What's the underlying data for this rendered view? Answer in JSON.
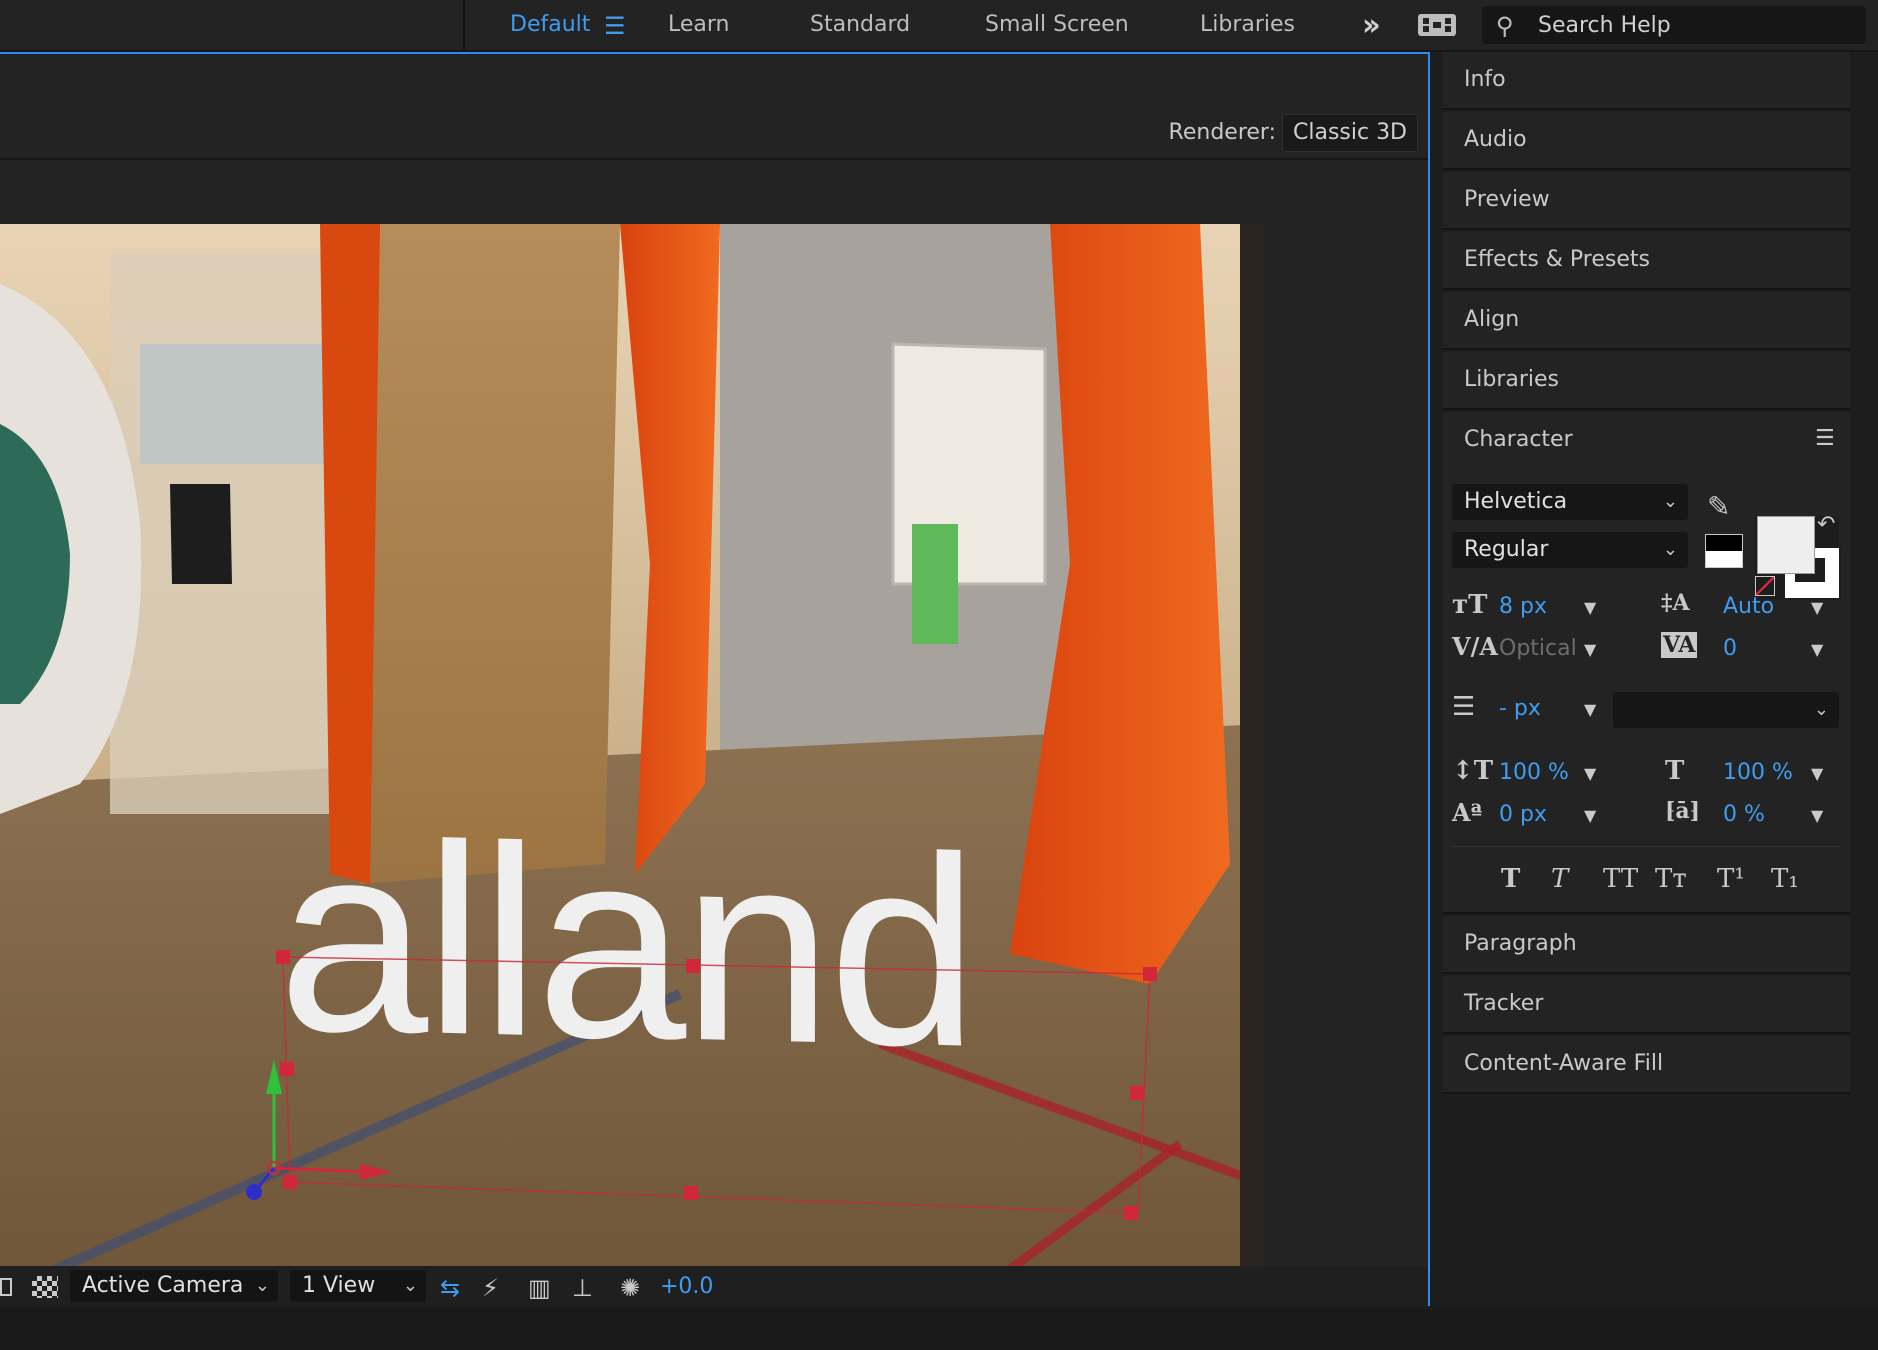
{
  "workspace": {
    "tabs": [
      "Default",
      "Learn",
      "Standard",
      "Small Screen",
      "Libraries"
    ],
    "active_tab": "Default",
    "search_placeholder": "Search Help"
  },
  "composition": {
    "renderer_label": "Renderer:",
    "renderer_value": "Classic 3D",
    "text_layer": "alland",
    "footer": {
      "camera": "Active Camera",
      "views": "1 View",
      "exposure": "+0.0"
    }
  },
  "panels": {
    "collapsed_top": [
      "Info",
      "Audio",
      "Preview",
      "Effects & Presets",
      "Align",
      "Libraries"
    ],
    "character_title": "Character",
    "collapsed_bottom": [
      "Paragraph",
      "Tracker",
      "Content-Aware Fill"
    ]
  },
  "character": {
    "font_family": "Helvetica",
    "font_style": "Regular",
    "font_size": "8 px",
    "leading": "Auto",
    "kerning": "Optical",
    "tracking": "0",
    "stroke_width": "- px",
    "vertical_scale": "100 %",
    "horizontal_scale": "100 %",
    "baseline_shift": "0 px",
    "tsume": "0 %",
    "style_buttons": [
      "T",
      "T",
      "TT",
      "Tт",
      "T¹",
      "T₁"
    ]
  },
  "colors": {
    "accent": "#3f9cf0",
    "panel_bg": "#232323",
    "handle_red": "#d0283a",
    "fill_color": "#eeeeee"
  }
}
